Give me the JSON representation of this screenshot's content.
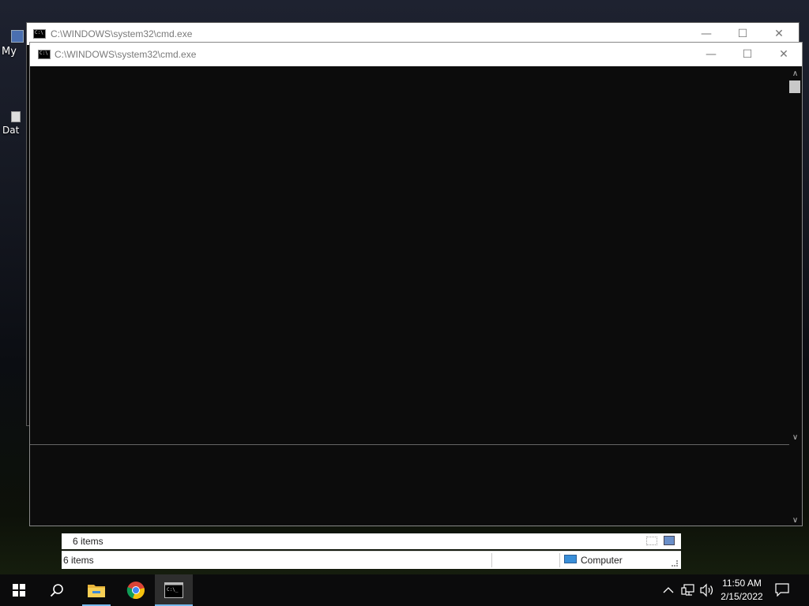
{
  "desktop": {
    "icon1_label": "My",
    "icon2_label": "Dat"
  },
  "back_window": {
    "title": "C:\\WINDOWS\\system32\\cmd.exe",
    "minimize": "—",
    "maximize": "☐",
    "close": "✕"
  },
  "front_window": {
    "title": "C:\\WINDOWS\\system32\\cmd.exe",
    "minimize": "—",
    "maximize": "☐",
    "close": "✕"
  },
  "explorer": {
    "status_top": "6 items",
    "status_bottom": "6 items",
    "location": "Computer"
  },
  "taskbar": {
    "time": "11:50 AM",
    "date": "2/15/2022",
    "items": [
      "start-icon",
      "search-icon",
      "file-explorer-icon",
      "chrome-icon",
      "cmd-icon"
    ]
  },
  "colors": {
    "console_bg": "#0c0c0c",
    "taskbar_bg": "#0b0b0c",
    "active_indicator": "#76b9ed"
  }
}
